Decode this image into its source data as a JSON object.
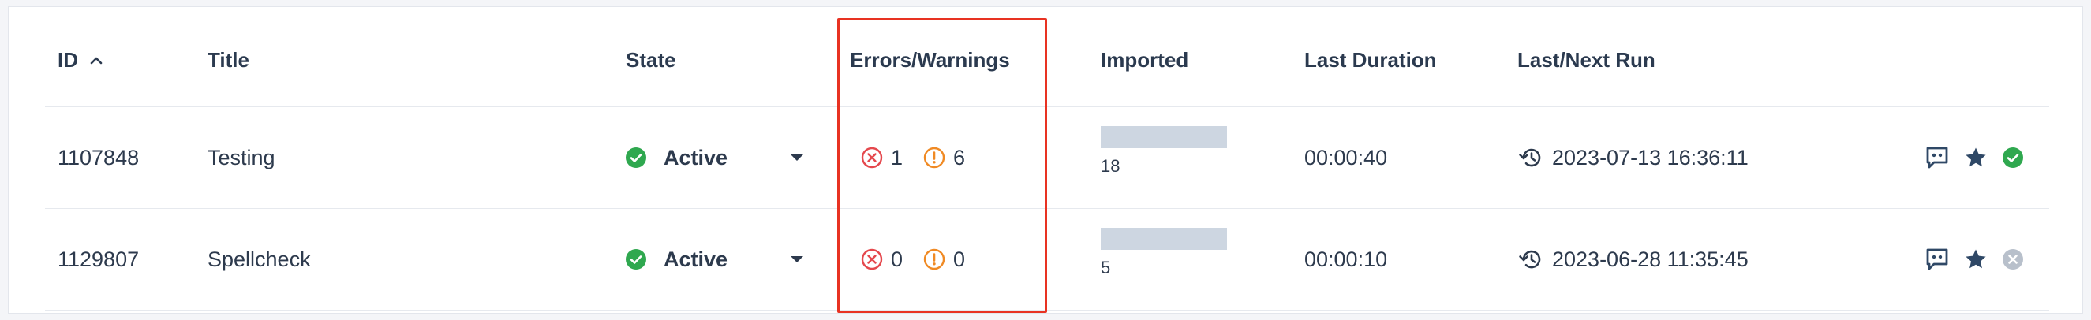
{
  "columns": {
    "id": "ID",
    "title": "Title",
    "state": "State",
    "errors_warnings": "Errors/Warnings",
    "imported": "Imported",
    "last_duration": "Last Duration",
    "last_next_run": "Last/Next Run"
  },
  "rows": [
    {
      "id": "1107848",
      "title": "Testing",
      "state": "Active",
      "errors": "1",
      "warnings": "6",
      "imported": "18",
      "imported_fraction": 1.0,
      "last_duration": "00:00:40",
      "last_run": "2023-07-13 16:36:11",
      "status_icon": "check-circle-icon"
    },
    {
      "id": "1129807",
      "title": "Spellcheck",
      "state": "Active",
      "errors": "0",
      "warnings": "0",
      "imported": "5",
      "imported_fraction": 1.0,
      "last_duration": "00:00:10",
      "last_run": "2023-06-28 11:35:45",
      "status_icon": "x-circle-icon"
    }
  ],
  "colors": {
    "active_green": "#2fa84f",
    "error_red": "#e5484d",
    "warning_orange": "#f08a24",
    "highlight_red": "#e83222",
    "icon_navy": "#2f4866",
    "status_grey": "#b8c0cb",
    "bar_fill": "#cdd6e1"
  }
}
